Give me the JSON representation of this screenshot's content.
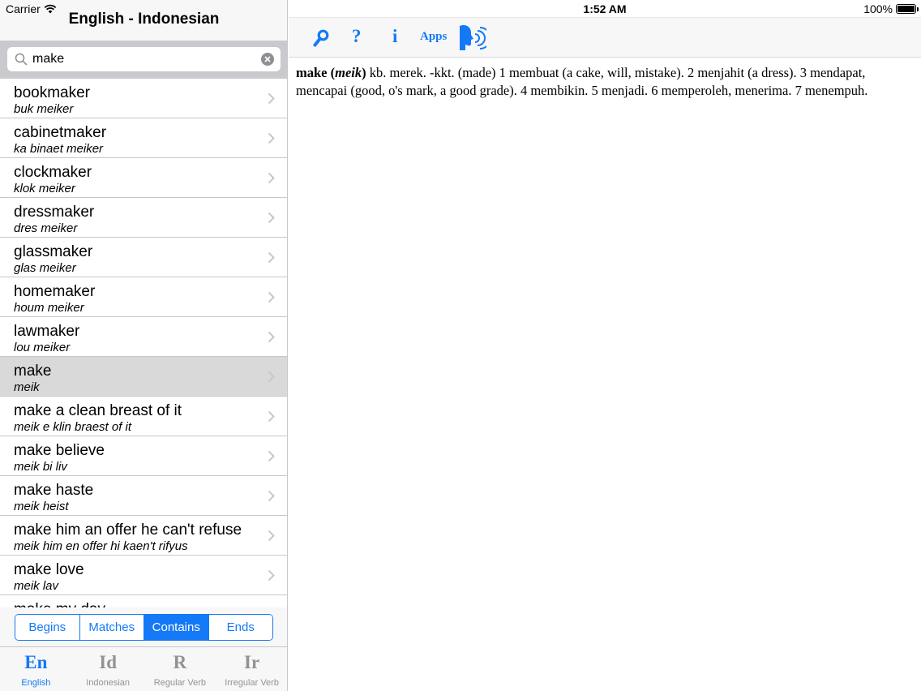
{
  "status_bar": {
    "carrier": "Carrier",
    "time": "1:52 AM",
    "battery": "100%"
  },
  "nav": {
    "title": "English - Indonesian"
  },
  "search": {
    "value": "make",
    "placeholder": ""
  },
  "results": [
    {
      "word": "bookmaker",
      "pron": "buk meiker"
    },
    {
      "word": "cabinetmaker",
      "pron": "ka binaet meiker"
    },
    {
      "word": "clockmaker",
      "pron": "klok meiker"
    },
    {
      "word": "dressmaker",
      "pron": "dres meiker"
    },
    {
      "word": "glassmaker",
      "pron": "glas meiker"
    },
    {
      "word": "homemaker",
      "pron": "houm meiker"
    },
    {
      "word": "lawmaker",
      "pron": "lou meiker"
    },
    {
      "word": "make",
      "pron": "meik",
      "selected": true
    },
    {
      "word": "make a clean breast of it",
      "pron": "meik e klin braest of it"
    },
    {
      "word": "make believe",
      "pron": "meik bi liv"
    },
    {
      "word": "make haste",
      "pron": "meik heist"
    },
    {
      "word": "make him an offer he can't refuse",
      "pron": "meik him en offer hi kaen't rifyus"
    },
    {
      "word": "make love",
      "pron": "meik lav"
    },
    {
      "word": "make my day",
      "pron": ""
    }
  ],
  "segments": {
    "items": [
      "Begins",
      "Matches",
      "Contains",
      "Ends"
    ],
    "active_index": 2
  },
  "tabs": [
    {
      "icon": "En",
      "label": "English",
      "active": true
    },
    {
      "icon": "Id",
      "label": "Indonesian",
      "active": false
    },
    {
      "icon": "R",
      "label": "Regular Verb",
      "active": false
    },
    {
      "icon": "Ir",
      "label": "Irregular Verb",
      "active": false
    }
  ],
  "toolbar": {
    "help_label": "?",
    "info_label": "i",
    "apps_label": "Apps",
    "icons": [
      "search-icon",
      "help-icon",
      "info-icon",
      "apps-button",
      "speak-icon"
    ]
  },
  "definition": {
    "headword": "make",
    "pronunciation": "meik",
    "body": "kb. merek. -kkt. (made) 1 membuat (a cake, will, mistake). 2 menjahit (a dress). 3 mendapat, mencapai (good, o's mark, a good grade). 4 membikin. 5 menjadi. 6 memperoleh, menerima. 7 menempuh."
  },
  "colors": {
    "accent": "#1479f6",
    "selected_row": "#d9d9d9",
    "inactive_tab": "#929292"
  }
}
